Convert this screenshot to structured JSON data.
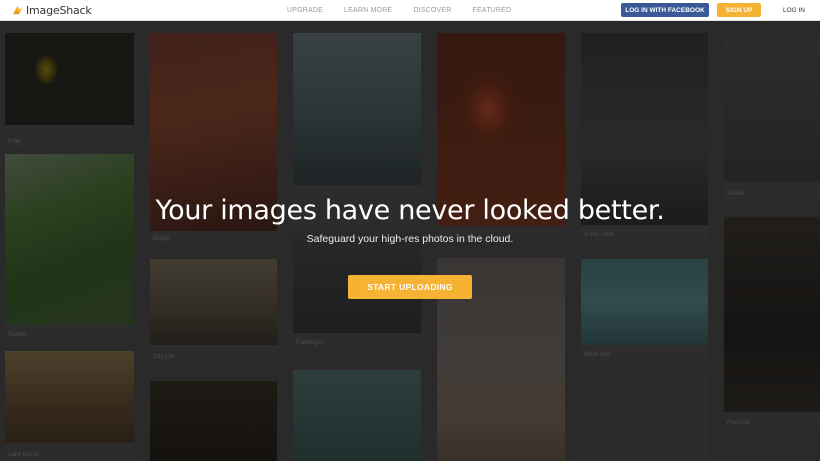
{
  "brand": {
    "name": "ImageShack",
    "accent": "#f6b232"
  },
  "nav": {
    "items": [
      "UPGRADE",
      "LEARN MORE",
      "DISCOVER",
      "FEATURED"
    ]
  },
  "auth": {
    "facebook": "LOG IN WITH FACEBOOK",
    "signup": "SIGN UP",
    "login": "LOG IN",
    "facebook_color": "#3b5998"
  },
  "hero": {
    "title": "Your images have never looked better.",
    "subtitle": "Safeguard your high-res photos in the cloud.",
    "cta": "START UPLOADING"
  },
  "cards": [
    {
      "caption": "Frog"
    },
    {
      "caption": "Maple"
    },
    {
      "caption": ""
    },
    {
      "caption": ""
    },
    {
      "caption": "In the zone"
    },
    {
      "caption": "Travel"
    },
    {
      "caption": "Scenic"
    },
    {
      "caption": "City Life"
    },
    {
      "caption": "Flamingos"
    },
    {
      "caption": ""
    },
    {
      "caption": "Wind Surf"
    },
    {
      "caption": "Porsche"
    },
    {
      "caption": "Lake house"
    },
    {
      "caption": ""
    },
    {
      "caption": ""
    },
    {
      "caption": ""
    }
  ]
}
